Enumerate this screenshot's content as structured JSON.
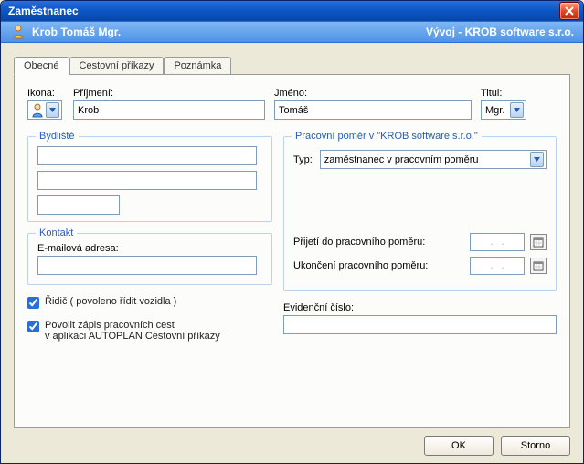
{
  "titlebar": {
    "title": "Zaměstnanec"
  },
  "subheader": {
    "name": "Krob Tomáš Mgr.",
    "org": "Vývoj - KROB software s.r.o."
  },
  "tabs": [
    {
      "label": "Obecné"
    },
    {
      "label": "Cestovní příkazy"
    },
    {
      "label": "Poznámka"
    }
  ],
  "labels": {
    "icon": "Ikona:",
    "surname": "Příjmení:",
    "firstname": "Jméno:",
    "title": "Titul:",
    "residence": "Bydliště",
    "contact": "Kontakt",
    "email": "E-mailová adresa:",
    "driver": "Řidič ( povoleno řídit vozidla )",
    "allow_trips_1": "Povolit zápis pracovních cest",
    "allow_trips_2": "v aplikaci AUTOPLAN Cestovní příkazy",
    "work_group": "Pracovní poměr v \"KROB software s.r.o.\"",
    "type": "Typ:",
    "start": "Přijetí do pracovního poměru:",
    "end": "Ukončení pracovního poměru:",
    "ev_num": "Evidenční číslo:"
  },
  "fields": {
    "surname": "Krob",
    "firstname": "Tomáš",
    "title": "Mgr.",
    "address1": "",
    "address2": "",
    "address3": "",
    "email": "",
    "work_type": "zaměstnanec v pracovním poměru",
    "date_start": ".   .",
    "date_end": ".   .",
    "ev_num": ""
  },
  "checkboxes": {
    "driver": true,
    "allow_trips": true
  },
  "buttons": {
    "ok": "OK",
    "cancel": "Storno"
  }
}
